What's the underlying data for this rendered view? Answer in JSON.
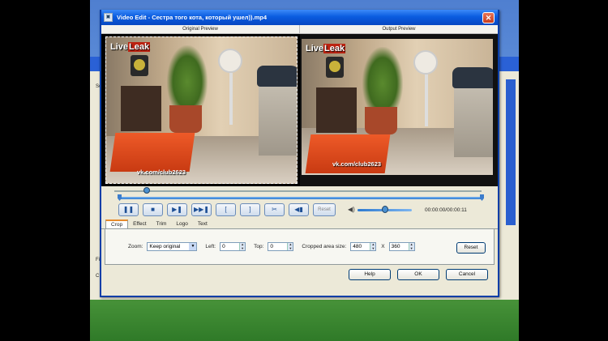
{
  "window": {
    "title": "Video Edit - Сестра того кота, который ушел)).mp4",
    "close_symbol": "✕"
  },
  "preview": {
    "original_label": "Original Preview",
    "output_label": "Output Preview",
    "logo_text": "Live",
    "logo_text_b": "Leak",
    "watermark": "vk.com/club2623"
  },
  "playback": {
    "seek_position_fraction": 0.08,
    "trim_start_fraction": 0.0,
    "trim_end_fraction": 1.0,
    "volume_fraction": 0.5,
    "time": "00:00:00/00:00:11",
    "reset_label": "Reset",
    "buttons": [
      "❚❚",
      "■",
      "▶❚",
      "▶▶❚",
      "[",
      "]",
      "✂",
      "◀▮"
    ]
  },
  "tabs": [
    "Crop",
    "Effect",
    "Trim",
    "Logo",
    "Text"
  ],
  "active_tab": "Crop",
  "crop": {
    "zoom_label": "Zoom:",
    "zoom_value": "Keep original",
    "left_label": "Left:",
    "left_value": "0",
    "top_label": "Top:",
    "top_value": "0",
    "size_label": "Cropped area size:",
    "width_value": "480",
    "x_label": "X",
    "height_value": "360",
    "reset_label": "Reset"
  },
  "footer": {
    "help_label": "Help",
    "ok_label": "OK",
    "cancel_label": "Cancel"
  },
  "background": {
    "left_text_1": "Sc",
    "left_text_2": "Fi",
    "left_text_3": "C"
  }
}
